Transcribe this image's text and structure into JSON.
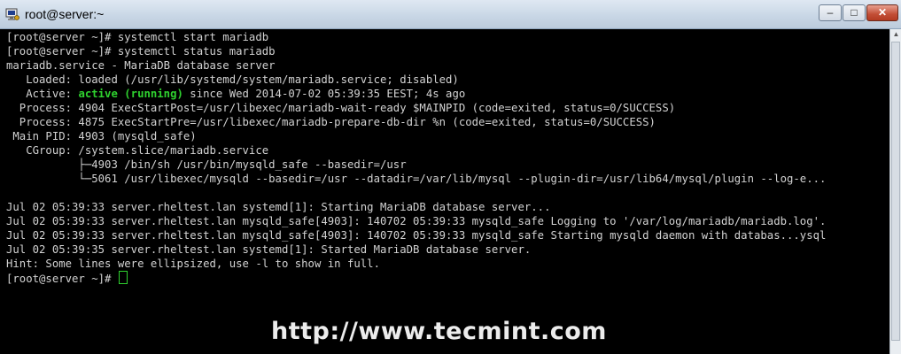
{
  "window": {
    "title": "root@server:~",
    "minimize_label": "–",
    "maximize_label": "□",
    "close_label": "✕"
  },
  "icons": {
    "app": "terminal-app-icon"
  },
  "terminal": {
    "lines": [
      "[root@server ~]# systemctl start mariadb",
      "[root@server ~]# systemctl status mariadb",
      "mariadb.service - MariaDB database server",
      "   Loaded: loaded (/usr/lib/systemd/system/mariadb.service; disabled)",
      "",
      "  Process: 4904 ExecStartPost=/usr/libexec/mariadb-wait-ready $MAINPID (code=exited, status=0/SUCCESS)",
      "  Process: 4875 ExecStartPre=/usr/libexec/mariadb-prepare-db-dir %n (code=exited, status=0/SUCCESS)",
      " Main PID: 4903 (mysqld_safe)",
      "   CGroup: /system.slice/mariadb.service",
      "           ├─4903 /bin/sh /usr/bin/mysqld_safe --basedir=/usr",
      "           └─5061 /usr/libexec/mysqld --basedir=/usr --datadir=/var/lib/mysql --plugin-dir=/usr/lib64/mysql/plugin --log-e...",
      "",
      "Jul 02 05:39:33 server.rheltest.lan systemd[1]: Starting MariaDB database server...",
      "Jul 02 05:39:33 server.rheltest.lan mysqld_safe[4903]: 140702 05:39:33 mysqld_safe Logging to '/var/log/mariadb/mariadb.log'.",
      "Jul 02 05:39:33 server.rheltest.lan mysqld_safe[4903]: 140702 05:39:33 mysqld_safe Starting mysqld daemon with databas...ysql",
      "Jul 02 05:39:35 server.rheltest.lan systemd[1]: Started MariaDB database server.",
      "Hint: Some lines were ellipsized, use -l to show in full.",
      ""
    ],
    "active_prefix": "   Active: ",
    "active_status": "active (running)",
    "active_suffix": " since Wed 2014-07-02 05:39:35 EEST; 4s ago",
    "prompt": "[root@server ~]# ",
    "text_color": "#d2d2d2",
    "status_color": "#2fd12f"
  },
  "watermark": {
    "text": "http://www.tecmint.com"
  }
}
